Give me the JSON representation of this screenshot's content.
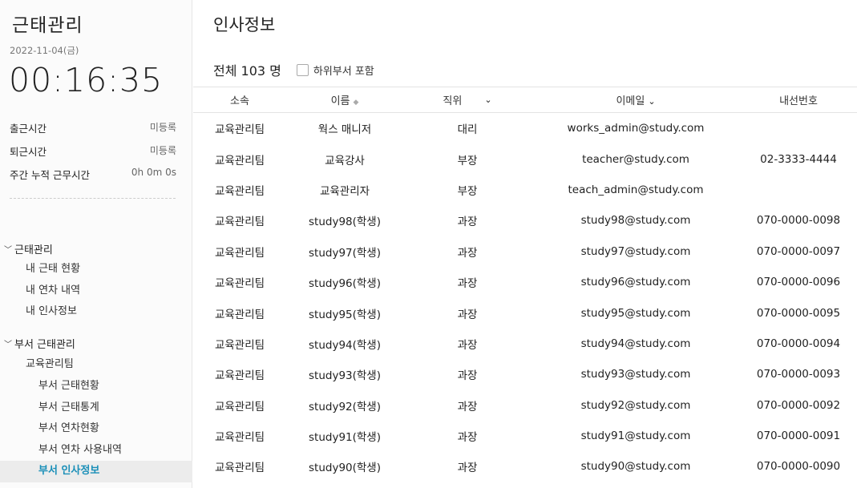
{
  "sidebar": {
    "title": "근태관리",
    "date": "2022-11-04(금)",
    "clock": "00:16:35",
    "stats": [
      {
        "label": "출근시간",
        "value": "미등록"
      },
      {
        "label": "퇴근시간",
        "value": "미등록"
      },
      {
        "label": "주간 누적 근무시간",
        "value": "0h 0m 0s"
      }
    ],
    "nav": {
      "group1": {
        "label": "근태관리",
        "items": [
          "내 근태 현황",
          "내 연차 내역",
          "내 인사정보"
        ]
      },
      "group2": {
        "label": "부서 근태관리",
        "subhead": "교육관리팀",
        "items": [
          "부서 근태현황",
          "부서 근태통계",
          "부서 연차현황",
          "부서 연차 사용내역",
          "부서 인사정보"
        ]
      }
    }
  },
  "main": {
    "title": "인사정보",
    "count": "전체 103 명",
    "include_sub_label": "하위부서 포함",
    "columns": [
      "소속",
      "이름",
      "직위",
      "이메일",
      "내선번호"
    ],
    "rows": [
      [
        "교육관리팀",
        "웍스 매니저",
        "대리",
        "works_admin@study.com",
        ""
      ],
      [
        "교육관리팀",
        "교육강사",
        "부장",
        "teacher@study.com",
        "02-3333-4444"
      ],
      [
        "교육관리팀",
        "교육관리자",
        "부장",
        "teach_admin@study.com",
        ""
      ],
      [
        "교육관리팀",
        "study98(학생)",
        "과장",
        "study98@study.com",
        "070-0000-0098"
      ],
      [
        "교육관리팀",
        "study97(학생)",
        "과장",
        "study97@study.com",
        "070-0000-0097"
      ],
      [
        "교육관리팀",
        "study96(학생)",
        "과장",
        "study96@study.com",
        "070-0000-0096"
      ],
      [
        "교육관리팀",
        "study95(학생)",
        "과장",
        "study95@study.com",
        "070-0000-0095"
      ],
      [
        "교육관리팀",
        "study94(학생)",
        "과장",
        "study94@study.com",
        "070-0000-0094"
      ],
      [
        "교육관리팀",
        "study93(학생)",
        "과장",
        "study93@study.com",
        "070-0000-0093"
      ],
      [
        "교육관리팀",
        "study92(학생)",
        "과장",
        "study92@study.com",
        "070-0000-0092"
      ],
      [
        "교육관리팀",
        "study91(학생)",
        "과장",
        "study91@study.com",
        "070-0000-0091"
      ],
      [
        "교육관리팀",
        "study90(학생)",
        "과장",
        "study90@study.com",
        "070-0000-0090"
      ]
    ]
  },
  "colors": {
    "active_nav": "#1a8fb8"
  }
}
